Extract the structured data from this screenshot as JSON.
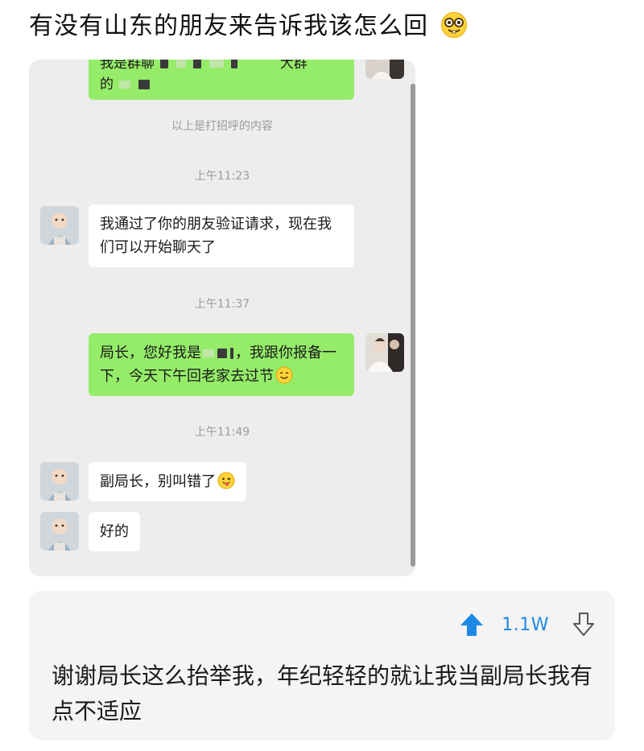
{
  "post": {
    "title": "有没有山东的朋友来告诉我该怎么回",
    "title_emoji": "nerd-face-emoji"
  },
  "chat": {
    "top_partial_text_line1": "我是群聊",
    "top_partial_text_line1_end": "大群",
    "top_partial_text_line2": "的",
    "greeting_note": "以上是打招呼的内容",
    "time_1": "上午11:23",
    "msg_1": "我通过了你的朋友验证请求，现在我们可以开始聊天了",
    "time_2": "上午11:37",
    "msg_2_part1": "局长，您好我是",
    "msg_2_part2": "，我跟你报备一下，今天下午回老家去过节",
    "msg_2_emoji": "smile-emoji",
    "time_3": "上午11:49",
    "msg_3": "副局长，别叫错了",
    "msg_3_emoji": "wink-tongue-emoji",
    "msg_4": "好的"
  },
  "comment": {
    "vote_count": "1.1W",
    "upvote_icon": "upvote-arrow-icon",
    "downvote_icon": "downvote-arrow-icon",
    "accent_color": "#1e88e5",
    "text": "谢谢局长这么抬举我，年纪轻轻的就让我当副局长我有点不适应"
  },
  "colors": {
    "chat_bg": "#ededed",
    "bubble_self": "#95ec69",
    "bubble_other": "#ffffff",
    "comment_bg": "#f4f4f4"
  }
}
